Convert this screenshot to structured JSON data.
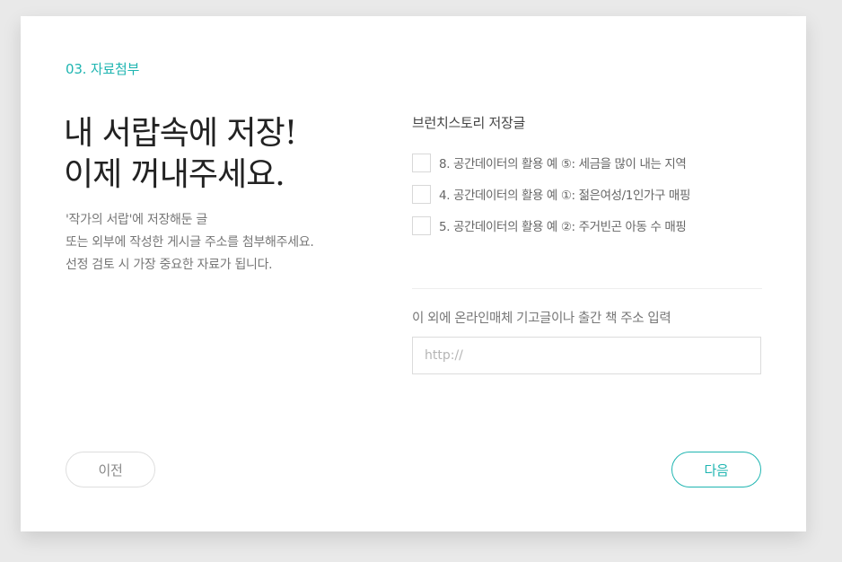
{
  "step": {
    "label": "03. 자료첨부"
  },
  "headline": {
    "line1": "내 서랍속에 저장!",
    "line2": "이제 꺼내주세요."
  },
  "description": {
    "line1": "'작가의 서랍'에 저장해둔 글",
    "line2": "또는 외부에 작성한 게시글 주소를 첨부해주세요.",
    "line3": "선정 검토 시 가장 중요한 자료가 됩니다."
  },
  "saved_posts": {
    "title": "브런치스토리 저장글",
    "items": [
      {
        "label": "8. 공간데이터의 활용 예 ⑤: 세금을 많이 내는 지역",
        "checked": false
      },
      {
        "label": "4. 공간데이터의 활용 예 ①: 젊은여성/1인가구 매핑",
        "checked": false
      },
      {
        "label": "5. 공간데이터의 활용 예 ②: 주거빈곤 아동 수 매핑",
        "checked": false
      }
    ]
  },
  "external": {
    "label": "이 외에 온라인매체 기고글이나 출간 책 주소 입력",
    "placeholder": "http://",
    "value": ""
  },
  "buttons": {
    "prev": "이전",
    "next": "다음"
  },
  "colors": {
    "accent": "#1fb5b1",
    "background": "#e9e9e9",
    "card": "#ffffff"
  }
}
